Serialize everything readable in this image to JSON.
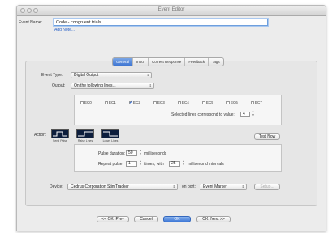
{
  "window": {
    "title": "Event Editor"
  },
  "header": {
    "event_name_label": "Event Name:",
    "event_name_value": "Code - congruent trials",
    "add_note_link": "Add Note..."
  },
  "tabs": [
    {
      "label": "General",
      "active": true
    },
    {
      "label": "Input",
      "active": false
    },
    {
      "label": "Correct Response",
      "active": false
    },
    {
      "label": "Feedback",
      "active": false
    },
    {
      "label": "Tags",
      "active": false
    }
  ],
  "form": {
    "event_type_label": "Event Type:",
    "event_type_value": "Digital Output",
    "output_label": "Output:",
    "output_value": "On the following lines...",
    "lines": [
      {
        "label": "EC0",
        "checked": false
      },
      {
        "label": "EC1",
        "checked": false
      },
      {
        "label": "EC2",
        "checked": true
      },
      {
        "label": "EC3",
        "checked": false
      },
      {
        "label": "EC4",
        "checked": false
      },
      {
        "label": "EC5",
        "checked": false
      },
      {
        "label": "EC6",
        "checked": false
      },
      {
        "label": "EC7",
        "checked": false
      }
    ],
    "selected_lines_label": "Selected lines correspond to value:",
    "selected_lines_value": "4",
    "action_label": "Action:",
    "actions": [
      {
        "label": "Send Pulse"
      },
      {
        "label": "Raise Lines"
      },
      {
        "label": "Lower Lines"
      }
    ],
    "test_now_button": "Test Now",
    "pulse_duration_label": "Pulse duration:",
    "pulse_duration_value": "50",
    "pulse_duration_unit": "milliseconds",
    "repeat_pulse_label": "Repeat pulse:",
    "repeat_pulse_value": "1",
    "times_with_label": "times, with",
    "interval_value": "25",
    "interval_unit": "millisecond intervals",
    "device_label": "Device:",
    "device_value": "Cedrus Corporation StimTracker",
    "on_port_label": "on port:",
    "port_value": "Event Marker",
    "setup_button": "Setup..."
  },
  "footer": {
    "prev_button": "<< OK, Prev",
    "cancel_button": "Cancel",
    "ok_button": "OK",
    "next_button": "OK, Next >>"
  },
  "colors": {
    "accent": "#3f76d2",
    "window_bg": "#ececec",
    "wave_bg": "#0d1e3d"
  }
}
